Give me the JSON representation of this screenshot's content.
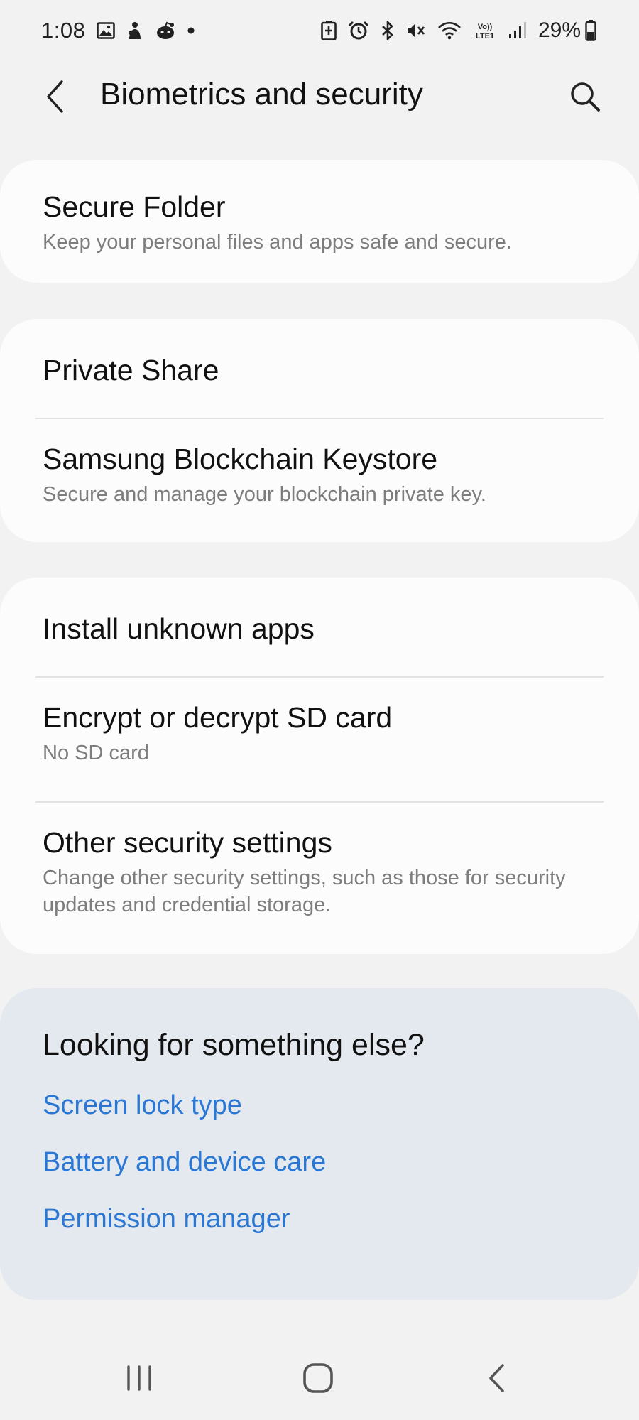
{
  "status_bar": {
    "time": "1:08",
    "battery": "29%",
    "left_icons": [
      "gallery-icon",
      "app-notification-icon",
      "reddit-icon",
      "dot-icon"
    ],
    "right_icons": [
      "battery-saver-icon",
      "alarm-icon",
      "bluetooth-icon",
      "mute-icon",
      "wifi-icon",
      "volte-icon",
      "signal-icon",
      "battery-icon"
    ],
    "volte_label": "Vo))\nLTE1"
  },
  "app_bar": {
    "title": "Biometrics and security"
  },
  "cards": [
    {
      "items": [
        {
          "title": "Secure Folder",
          "subtitle": "Keep your personal files and apps safe and secure."
        }
      ]
    },
    {
      "items": [
        {
          "title": "Private Share",
          "subtitle": ""
        },
        {
          "title": "Samsung Blockchain Keystore",
          "subtitle": "Secure and manage your blockchain private key."
        }
      ]
    },
    {
      "items": [
        {
          "title": "Install unknown apps",
          "subtitle": ""
        },
        {
          "title": "Encrypt or decrypt SD card",
          "subtitle": "No SD card"
        },
        {
          "title": "Other security settings",
          "subtitle": "Change other security settings, such as those for security updates and credential storage."
        }
      ]
    }
  ],
  "suggestions": {
    "title": "Looking for something else?",
    "links": [
      "Screen lock type",
      "Battery and device care",
      "Permission manager"
    ]
  },
  "colors": {
    "background": "#f2f2f2",
    "card": "#fcfcfc",
    "suggest_card": "#e4e8ef",
    "link": "#2a78d4",
    "subtitle": "#7d7d7d"
  }
}
